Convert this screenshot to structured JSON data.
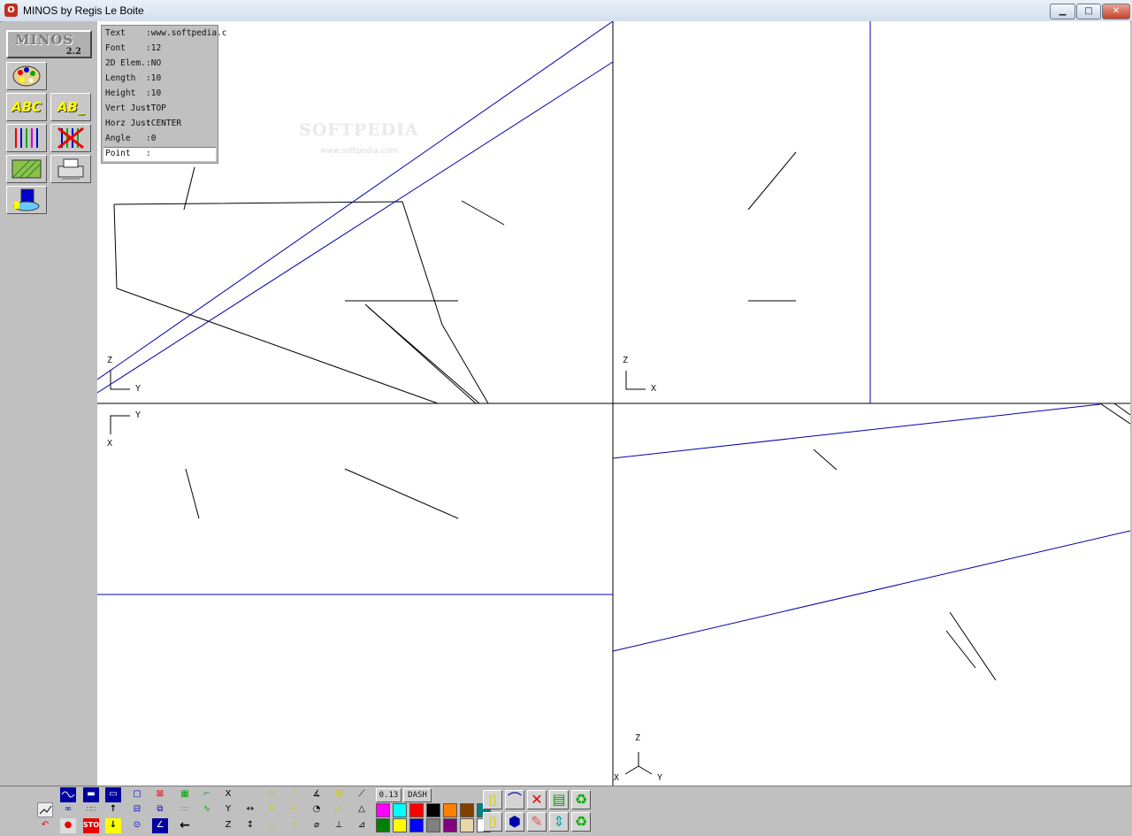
{
  "window": {
    "title": "MINOS by Regis Le Boite",
    "icon": "app-logo-icon",
    "controls": [
      "minimize-icon",
      "maximize-icon",
      "close-icon"
    ]
  },
  "logo": {
    "name": "MINOS",
    "version": "2.2"
  },
  "toolbox": {
    "text_tools": [
      "ABC",
      "AB_"
    ]
  },
  "info_panel": {
    "rows": [
      {
        "label": "Text",
        "value": ":www.softpedia.c"
      },
      {
        "label": "Font",
        "value": ":12"
      },
      {
        "label": "2D Elem.",
        "value": ":NO"
      },
      {
        "label": "Length",
        "value": ":10"
      },
      {
        "label": "Height",
        "value": ":10"
      },
      {
        "label": "Vert Just",
        "value": ":TOP"
      },
      {
        "label": "Horz Just",
        "value": ":CENTER"
      },
      {
        "label": "Angle",
        "value": ":0"
      }
    ],
    "point": {
      "label": "Point",
      "value": ":"
    }
  },
  "watermark": {
    "text": "SOFTPEDIA",
    "url": "www.softpedia.com"
  },
  "viewports": [
    {
      "axes": [
        "Z",
        "Y"
      ]
    },
    {
      "axes": [
        "Z",
        "X"
      ]
    },
    {
      "axes": [
        "Y",
        "X"
      ]
    },
    {
      "axes": [
        "Z",
        "X",
        "Y"
      ]
    }
  ],
  "bottom_toolbar": {
    "coord_labels": [
      "X",
      "Y",
      "Z"
    ],
    "line_width": "0.13",
    "line_style": "DASH",
    "stop_label": "STOP",
    "palette": [
      "#ff00ff",
      "#00ffff",
      "#ff0000",
      "#000000",
      "#ff8000",
      "#804000",
      "#008080",
      "#008000",
      "#ffff00",
      "#0000ff",
      "#808080",
      "#800080",
      "#e8d8a8",
      "#ffffff"
    ]
  }
}
